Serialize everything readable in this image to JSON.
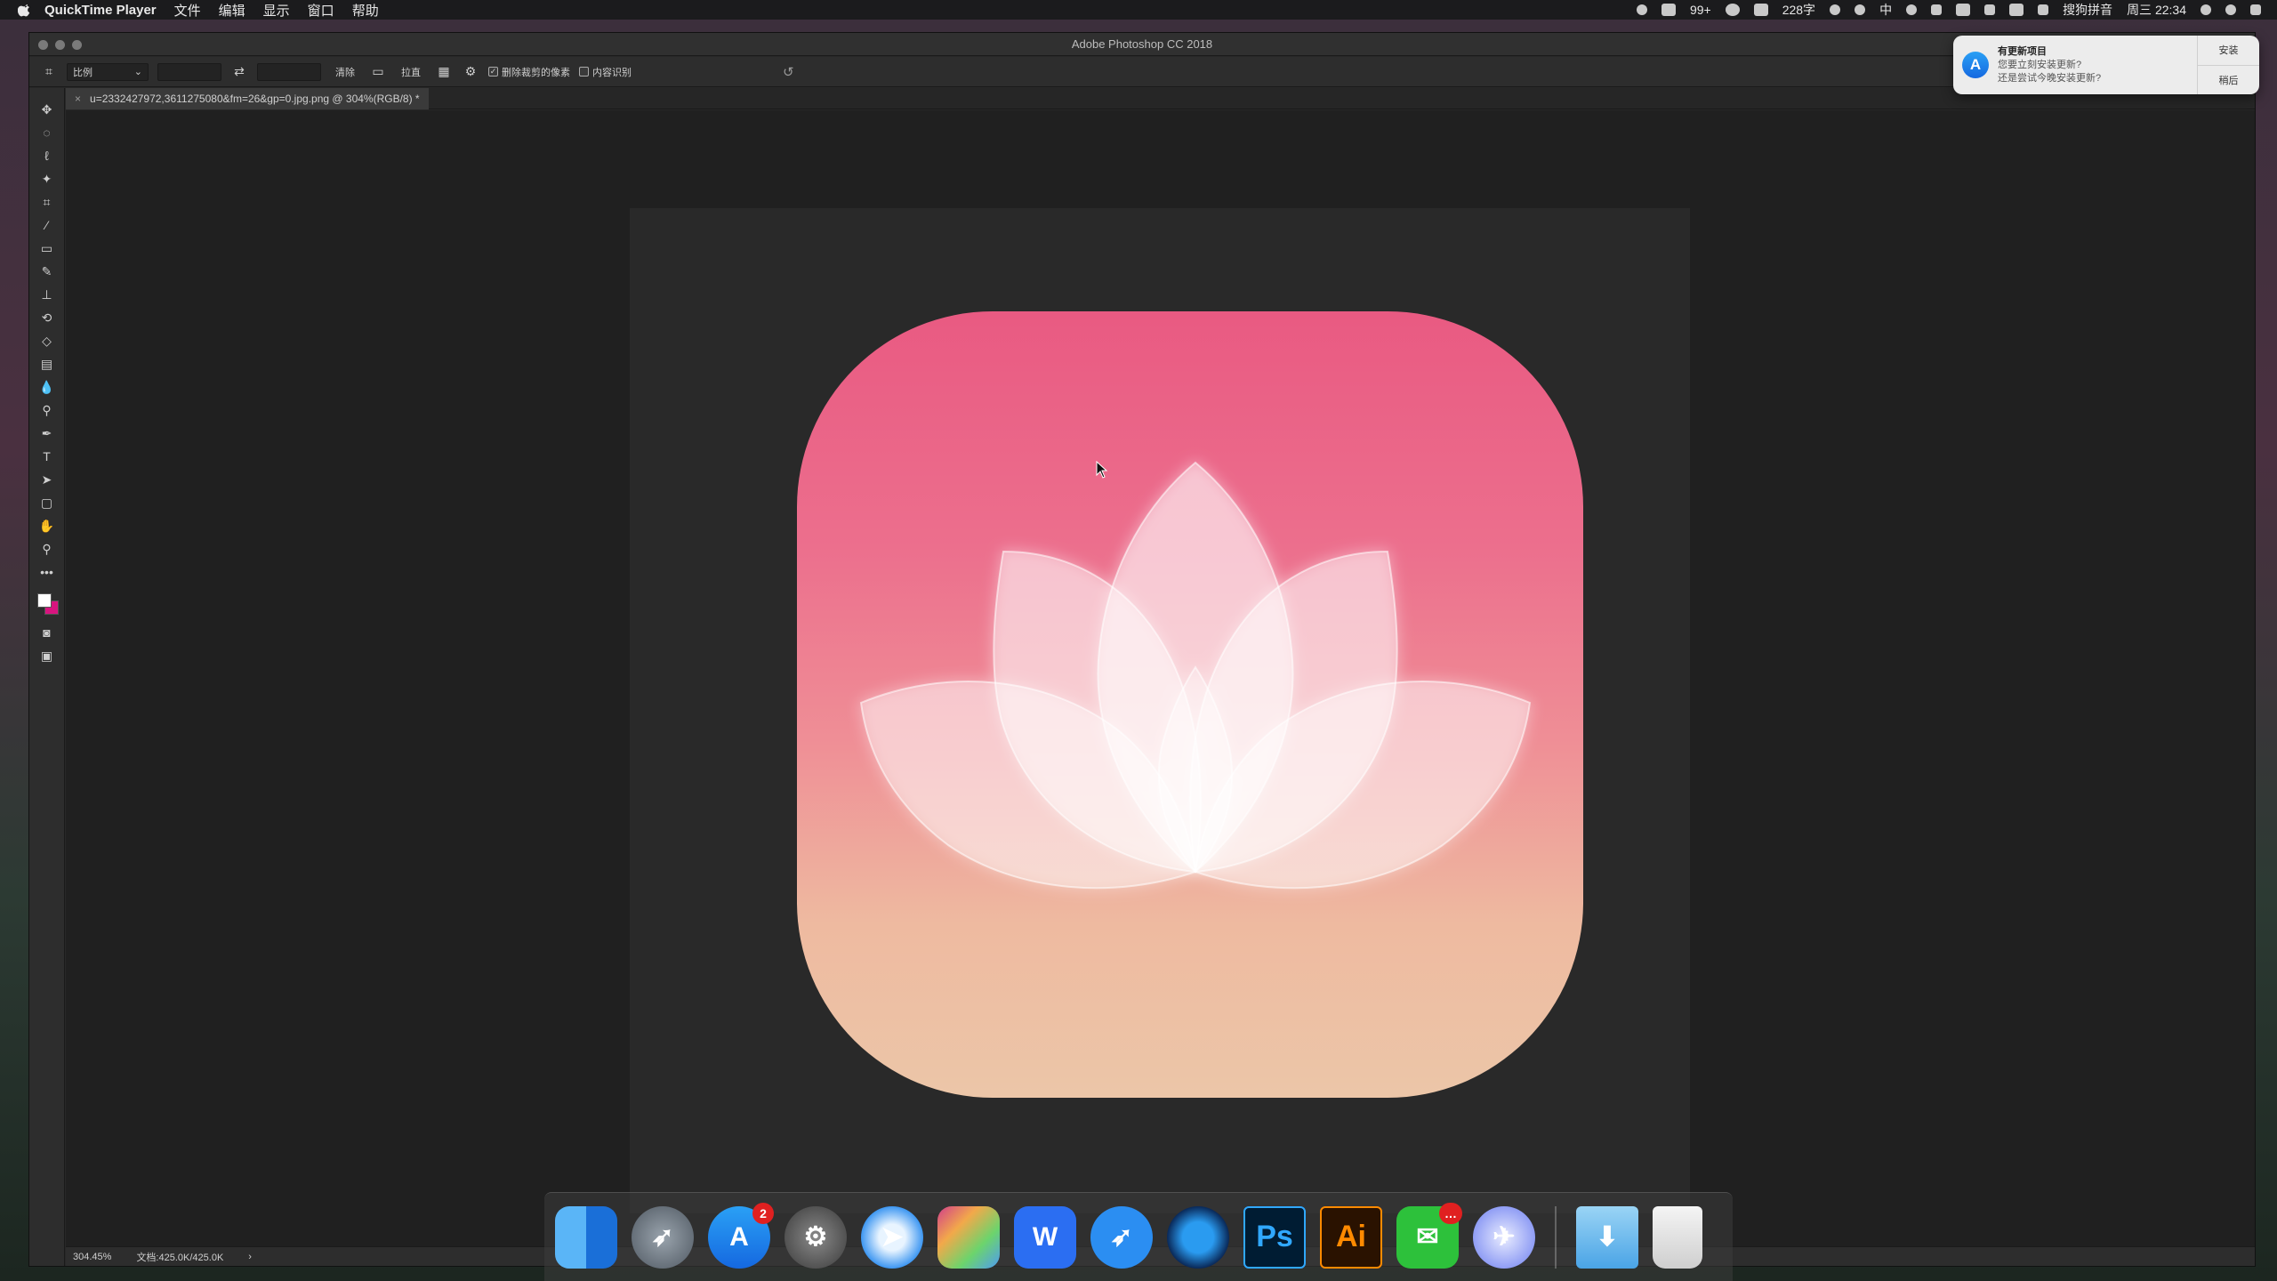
{
  "menubar": {
    "app_name": "QuickTime Player",
    "menus": [
      "文件",
      "编辑",
      "显示",
      "窗口",
      "帮助"
    ],
    "wechat_count": "99+",
    "word_count": "228字",
    "input_method_short": "中",
    "input_method": "搜狗拼音",
    "clock": "周三 22:34"
  },
  "window": {
    "title": "Adobe Photoshop CC 2018"
  },
  "options_bar": {
    "ratio_select": "比例",
    "clear_button": "清除",
    "straighten_button": "拉直",
    "delete_cropped_label": "删除裁剪的像素",
    "delete_cropped_checked": true,
    "content_aware_label": "内容识别",
    "content_aware_checked": false
  },
  "document": {
    "tab_title": "u=2332427972,3611275080&fm=26&gp=0.jpg.png @ 304%(RGB/8) *",
    "close_glyph": "×"
  },
  "tools": {
    "foreground_color": "#ffffff",
    "background_color": "#d8147f"
  },
  "status_bar": {
    "zoom": "304.45%",
    "doc_size": "文档:425.0K/425.0K",
    "arrow": "›"
  },
  "notification": {
    "title": "有更新项目",
    "line1": "您要立刻安装更新?",
    "line2": "还是尝试今晚安装更新?",
    "install_button": "安装",
    "later_button": "稍后"
  },
  "dock": {
    "apps": [
      {
        "name": "Finder",
        "icon": "finder-icon"
      },
      {
        "name": "Launchpad",
        "icon": "rocket-icon"
      },
      {
        "name": "App Store",
        "icon": "app-store-icon",
        "badge": "2"
      },
      {
        "name": "System Preferences",
        "icon": "gear-icon"
      },
      {
        "name": "Safari",
        "icon": "compass-icon"
      },
      {
        "name": "Final Cut Pro",
        "icon": "clapperboard-icon"
      },
      {
        "name": "WPS",
        "icon": "wps-icon"
      },
      {
        "name": "Lark",
        "icon": "lark-icon"
      },
      {
        "name": "Browser",
        "icon": "browser-icon"
      },
      {
        "name": "Photoshop",
        "icon": "photoshop-icon",
        "label": "Ps"
      },
      {
        "name": "Illustrator",
        "icon": "illustrator-icon",
        "label": "Ai"
      },
      {
        "name": "WeChat",
        "icon": "wechat-icon",
        "badge": "…"
      },
      {
        "name": "Bird App",
        "icon": "bird-icon"
      },
      {
        "name": "Downloads",
        "icon": "downloads-folder-icon"
      },
      {
        "name": "Trash",
        "icon": "trash-icon"
      }
    ]
  },
  "colors": {
    "icon_top": "#e95a82",
    "icon_bottom": "#ecc6a8",
    "ps_panel": "#2d2d2d",
    "ps_canvas": "#202020"
  }
}
